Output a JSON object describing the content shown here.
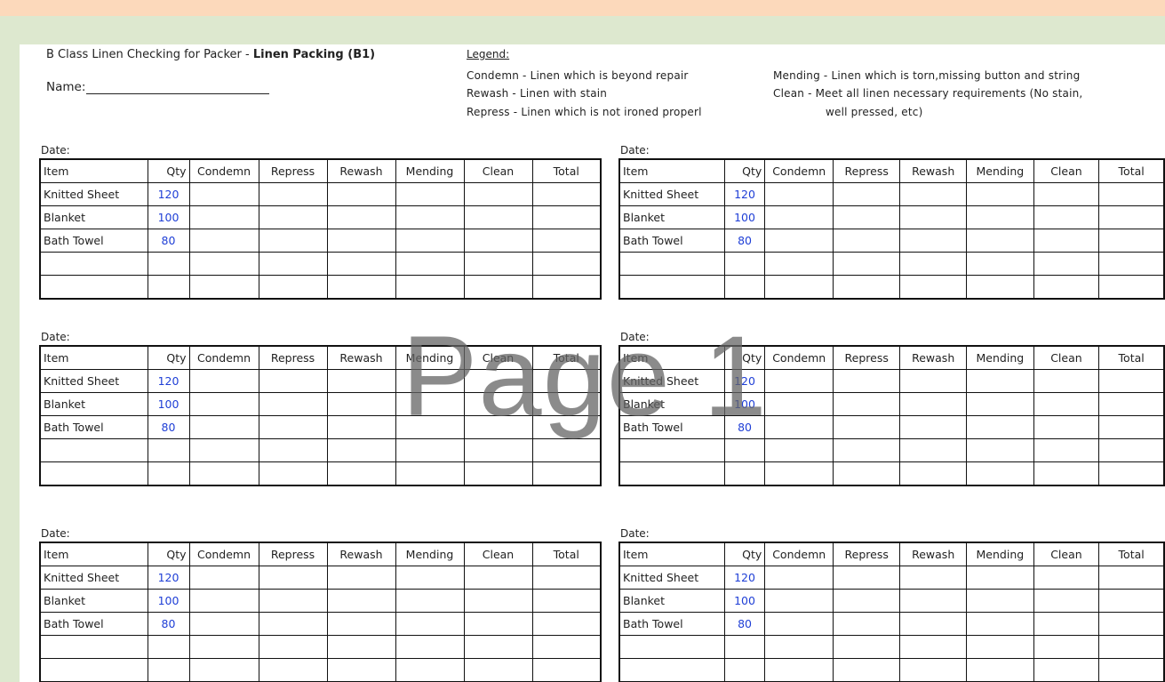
{
  "header": {
    "title_prefix": "B Class Linen Checking for Packer - ",
    "title_bold": "Linen Packing (B1)",
    "name_label": "Name:"
  },
  "legend": {
    "title": "Legend:",
    "condemn": "Condemn - Linen which is beyond repair",
    "rewash": "Rewash - Linen with stain",
    "repress": "Repress - Linen which is not ironed properl",
    "mending": "Mending - Linen which is torn,missing button and string",
    "clean": "Clean - Meet all linen necessary requirements (No stain,",
    "clean_cont": "well pressed, etc)"
  },
  "watermark": "Page 1",
  "date_label": "Date:",
  "columns": [
    "Item",
    "Qty",
    "Condemn",
    "Repress",
    "Rewash",
    "Mending",
    "Clean",
    "Total"
  ],
  "rows": [
    {
      "item": "Knitted Sheet",
      "qty": "120"
    },
    {
      "item": "Blanket",
      "qty": "100"
    },
    {
      "item": "Bath Towel",
      "qty": "80"
    },
    {
      "item": "",
      "qty": ""
    },
    {
      "item": "",
      "qty": ""
    }
  ]
}
